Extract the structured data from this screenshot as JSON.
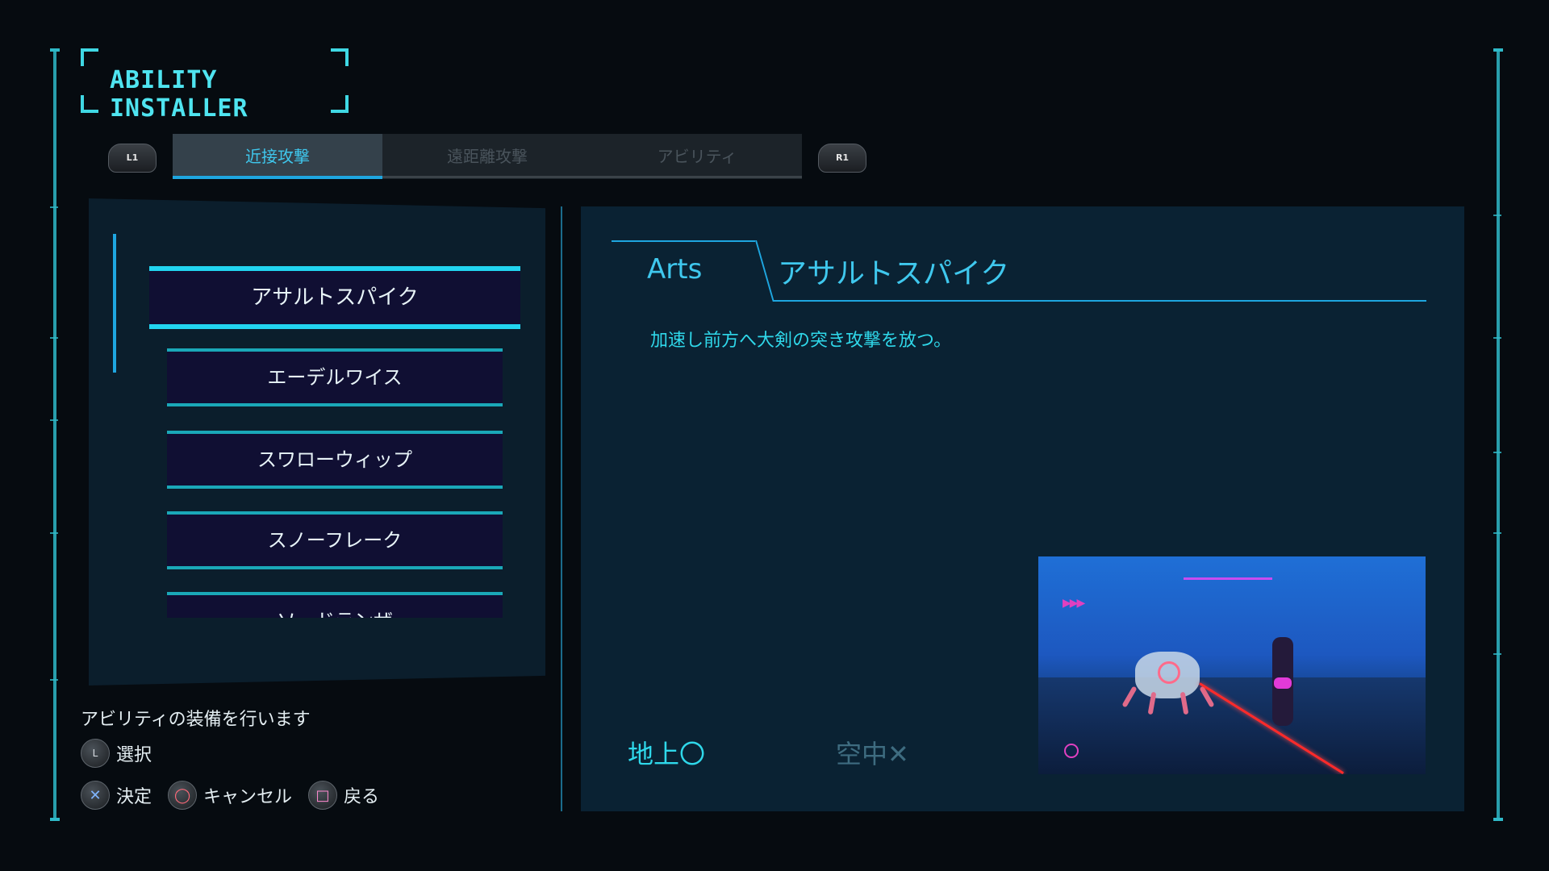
{
  "title": "ABILITY INSTALLER",
  "shoulder": {
    "left": "L1",
    "right": "R1"
  },
  "tabs": [
    {
      "label": "近接攻撃",
      "active": true
    },
    {
      "label": "遠距離攻撃",
      "active": false
    },
    {
      "label": "アビリティ",
      "active": false
    }
  ],
  "ability_list": [
    {
      "label": "アサルトスパイク",
      "selected": true
    },
    {
      "label": "エーデルワイス",
      "selected": false
    },
    {
      "label": "スワローウィップ",
      "selected": false
    },
    {
      "label": "スノーフレーク",
      "selected": false
    },
    {
      "label": "ソードランザ",
      "selected": false
    }
  ],
  "hints": {
    "title": "アビリティの装備を行います",
    "select_label": "選択",
    "select_button": "L",
    "confirm_label": "決定",
    "confirm_button": "✕",
    "cancel_label": "キャンセル",
    "cancel_button": "◯",
    "back_label": "戻る",
    "back_button": "□"
  },
  "detail": {
    "category": "Arts",
    "name": "アサルトスパイク",
    "description": "加速し前方へ大剣の突き攻撃を放つ。",
    "ground": "地上〇",
    "air": "空中✕"
  },
  "colors": {
    "accent": "#3fc8ee",
    "frame": "#2fb9c8",
    "list_bg": "#100f33",
    "panel_bg": "#0a2233"
  }
}
